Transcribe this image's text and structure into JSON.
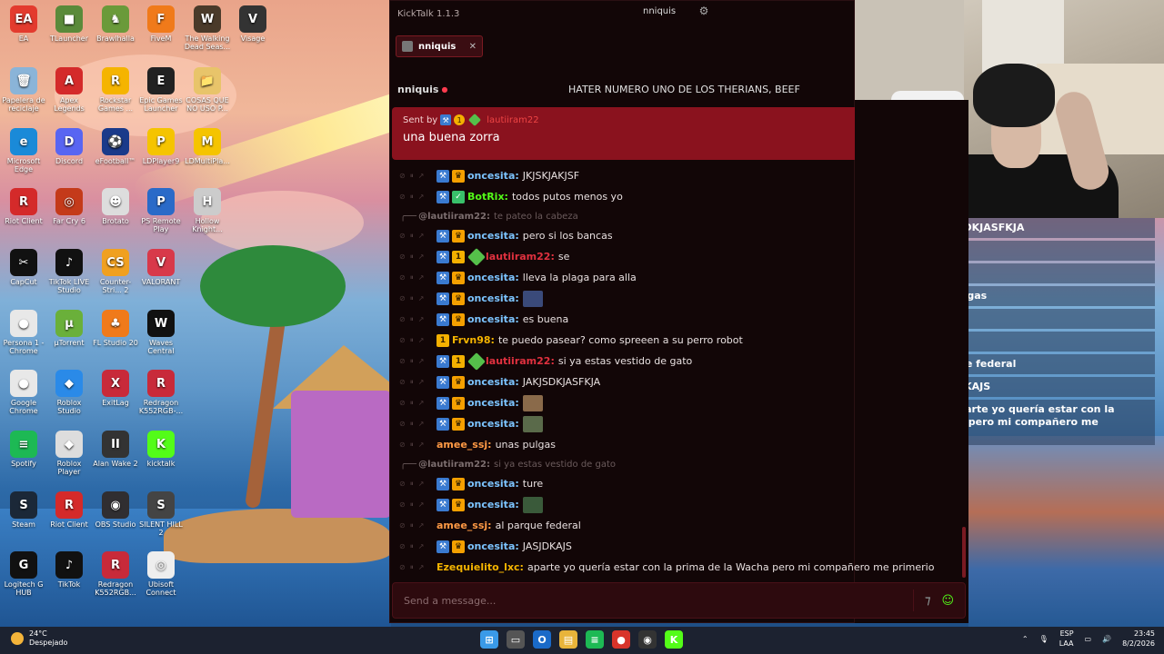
{
  "desktop": {
    "icons": [
      {
        "label": "EA",
        "color": "#e33b2e",
        "glyph": "EA"
      },
      {
        "label": "TLauncher",
        "color": "#5a8a3a",
        "glyph": "■"
      },
      {
        "label": "Brawlhalla",
        "color": "#6a9a3a",
        "glyph": "♞"
      },
      {
        "label": "FiveM",
        "color": "#f07a1a",
        "glyph": "F"
      },
      {
        "label": "The Walking Dead Seas...",
        "color": "#4a3a2a",
        "glyph": "W"
      },
      {
        "label": "Visage",
        "color": "#333",
        "glyph": "V"
      },
      {
        "label": "Papelera de reciclaje",
        "color": "#8ab4d8",
        "glyph": "🗑"
      },
      {
        "label": "Apex Legends",
        "color": "#d42a2a",
        "glyph": "A"
      },
      {
        "label": "Rockstar Games ...",
        "color": "#f5b400",
        "glyph": "R"
      },
      {
        "label": "Epic Games Launcher",
        "color": "#222",
        "glyph": "E"
      },
      {
        "label": "COSAS QUE NO USO P...",
        "color": "#e8c46a",
        "glyph": "📁"
      },
      {
        "label": "Microsoft Edge",
        "color": "#1a8ad8",
        "glyph": "e"
      },
      {
        "label": "Discord",
        "color": "#5865f2",
        "glyph": "D"
      },
      {
        "label": "eFootball™",
        "color": "#1a3a8a",
        "glyph": "⚽"
      },
      {
        "label": "LDPlayer9",
        "color": "#f5c400",
        "glyph": "P"
      },
      {
        "label": "LDMultiPla...",
        "color": "#f5c400",
        "glyph": "M"
      },
      {
        "label": "Riot Client",
        "color": "#d42a2a",
        "glyph": "R"
      },
      {
        "label": "Far Cry 6",
        "color": "#c43a1a",
        "glyph": "◎"
      },
      {
        "label": "Brotato",
        "color": "#ddd",
        "glyph": "☻"
      },
      {
        "label": "PS Remote Play",
        "color": "#2a6ac8",
        "glyph": "P"
      },
      {
        "label": "Hollow Knight...",
        "color": "#ccc",
        "glyph": "H"
      },
      {
        "label": "CapCut",
        "color": "#111",
        "glyph": "✂"
      },
      {
        "label": "TikTok LIVE Studio",
        "color": "#111",
        "glyph": "♪"
      },
      {
        "label": "Counter-Stri... 2",
        "color": "#f0a020",
        "glyph": "CS"
      },
      {
        "label": "VALORANT",
        "color": "#d8394a",
        "glyph": "V"
      },
      {
        "label": "Persona 1 - Chrome",
        "color": "#e8e8e8",
        "glyph": "●"
      },
      {
        "label": "µTorrent",
        "color": "#6ab03a",
        "glyph": "µ"
      },
      {
        "label": "FL Studio 20",
        "color": "#f07a1a",
        "glyph": "♣"
      },
      {
        "label": "Waves Central",
        "color": "#111",
        "glyph": "W"
      },
      {
        "label": "Google Chrome",
        "color": "#e8e8e8",
        "glyph": "●"
      },
      {
        "label": "Roblox Studio",
        "color": "#2a8ae8",
        "glyph": "◆"
      },
      {
        "label": "ExitLag",
        "color": "#c82a3a",
        "glyph": "X"
      },
      {
        "label": "Redragon K552RGB-...",
        "color": "#c82a3a",
        "glyph": "R"
      },
      {
        "label": "Spotify",
        "color": "#1db954",
        "glyph": "≡"
      },
      {
        "label": "Roblox Player",
        "color": "#ddd",
        "glyph": "◆"
      },
      {
        "label": "Alan Wake 2",
        "color": "#333",
        "glyph": "II"
      },
      {
        "label": "kicktalk",
        "color": "#53fc18",
        "glyph": "K"
      },
      {
        "label": "Steam",
        "color": "#1b2838",
        "glyph": "S"
      },
      {
        "label": "Riot Client",
        "color": "#d42a2a",
        "glyph": "R"
      },
      {
        "label": "OBS Studio",
        "color": "#302e31",
        "glyph": "◉"
      },
      {
        "label": "SILENT HILL 2",
        "color": "#444",
        "glyph": "S"
      },
      {
        "label": "Logitech G HUB",
        "color": "#111",
        "glyph": "G"
      },
      {
        "label": "TikTok",
        "color": "#111",
        "glyph": "♪"
      },
      {
        "label": "Redragon K552RGB...",
        "color": "#c82a3a",
        "glyph": "R"
      },
      {
        "label": "Ubisoft Connect",
        "color": "#eee",
        "glyph": "◎"
      }
    ]
  },
  "overlay": {
    "messages": [
      {
        "user": "oncesita:",
        "text": "JAKJSDKJASFKJA",
        "badges": true,
        "cls": "",
        "emote": false
      },
      {
        "user": "oncesita:",
        "text": "",
        "badges": true,
        "cls": "",
        "emote": true
      },
      {
        "user": "oncesita:",
        "text": "",
        "badges": true,
        "cls": "",
        "emote": true
      },
      {
        "user": "amee_ssj:",
        "text": "unas pulgas",
        "badges": false,
        "cls": "amee",
        "emote": false
      },
      {
        "user": "oncesita:",
        "text": "ture",
        "badges": true,
        "cls": "",
        "emote": false
      },
      {
        "user": "oncesita:",
        "text": "",
        "badges": true,
        "cls": "",
        "emote": true
      },
      {
        "user": "amee_ssj:",
        "text": "al parque federal",
        "badges": false,
        "cls": "amee",
        "emote": false
      },
      {
        "user": "oncesita:",
        "text": "JASJDKAJS",
        "badges": true,
        "cls": "",
        "emote": false
      },
      {
        "user": "Ezequielito_lxc:",
        "text": "aparte yo quería estar con la prima de la Wacha pero mi compañero me primerio",
        "badges": false,
        "cls": "ezq",
        "emote": false
      }
    ]
  },
  "kicktalk": {
    "app_title": "KickTalk 1.1.3",
    "username": "nniquis",
    "tab_label": "nniquis",
    "channel_name": "nniquis",
    "stream_title": "HATER NUMERO UNO DE LOS THERIANS, BEEF",
    "reply_banner": {
      "sent_by_label": "Sent by",
      "sender": "lautiiram22",
      "message": "una buena zorra"
    },
    "chat": [
      {
        "type": "msg",
        "badges": [
          "mod",
          "vip"
        ],
        "user": "oncesita:",
        "color": "#7cc4ff",
        "text": "JKJSKJAKJSF"
      },
      {
        "type": "msg",
        "badges": [
          "mod",
          "og"
        ],
        "user": "BotRix:",
        "color": "#53fc18",
        "text": "todos putos menos yo"
      },
      {
        "type": "reply",
        "user": "@lautiiram22:",
        "text": "te pateo la cabeza"
      },
      {
        "type": "msg",
        "badges": [
          "mod",
          "vip"
        ],
        "user": "oncesita:",
        "color": "#7cc4ff",
        "text": "pero si los bancas"
      },
      {
        "type": "msg",
        "badges": [
          "mod",
          "sub",
          "gift"
        ],
        "user": "lautiiram22:",
        "color": "#e0313f",
        "text": "se"
      },
      {
        "type": "msg",
        "badges": [
          "mod",
          "vip"
        ],
        "user": "oncesita:",
        "color": "#7cc4ff",
        "text": "lleva la plaga para alla"
      },
      {
        "type": "msg",
        "badges": [
          "mod",
          "vip"
        ],
        "user": "oncesita:",
        "color": "#7cc4ff",
        "text": "",
        "emote": "#3a4a7a"
      },
      {
        "type": "msg",
        "badges": [
          "mod",
          "vip"
        ],
        "user": "oncesita:",
        "color": "#7cc4ff",
        "text": "es buena"
      },
      {
        "type": "msg",
        "badges": [
          "sub"
        ],
        "user": "Frvn98:",
        "color": "#f5b400",
        "text": "te puedo pasear? como spreeen a su perro robot"
      },
      {
        "type": "msg",
        "badges": [
          "mod",
          "sub",
          "gift"
        ],
        "user": "lautiiram22:",
        "color": "#e0313f",
        "text": "si ya estas vestido de gato"
      },
      {
        "type": "msg",
        "badges": [
          "mod",
          "vip"
        ],
        "user": "oncesita:",
        "color": "#7cc4ff",
        "text": "JAKJSDKJASFKJA"
      },
      {
        "type": "msg",
        "badges": [
          "mod",
          "vip"
        ],
        "user": "oncesita:",
        "color": "#7cc4ff",
        "text": "",
        "emote": "#8a6a4a"
      },
      {
        "type": "msg",
        "badges": [
          "mod",
          "vip"
        ],
        "user": "oncesita:",
        "color": "#7cc4ff",
        "text": "",
        "emote": "#5a6a4a"
      },
      {
        "type": "msg",
        "badges": [],
        "user": "amee_ssj:",
        "color": "#ff9a45",
        "text": "unas pulgas"
      },
      {
        "type": "reply",
        "user": "@lautiiram22:",
        "text": "si ya estas vestido de gato"
      },
      {
        "type": "msg",
        "badges": [
          "mod",
          "vip"
        ],
        "user": "oncesita:",
        "color": "#7cc4ff",
        "text": "ture"
      },
      {
        "type": "msg",
        "badges": [
          "mod",
          "vip"
        ],
        "user": "oncesita:",
        "color": "#7cc4ff",
        "text": "",
        "emote": "#3a5a3a"
      },
      {
        "type": "msg",
        "badges": [],
        "user": "amee_ssj:",
        "color": "#ff9a45",
        "text": "al parque federal"
      },
      {
        "type": "msg",
        "badges": [
          "mod",
          "vip"
        ],
        "user": "oncesita:",
        "color": "#7cc4ff",
        "text": "JASJDKAJS"
      },
      {
        "type": "msg",
        "badges": [],
        "user": "Ezequielito_lxc:",
        "color": "#f5b400",
        "text": "aparte yo quería estar con la prima de la Wacha pero mi compañero me primerio"
      }
    ],
    "input_placeholder": "Send a message..."
  },
  "taskbar": {
    "temperature": "24°C",
    "weather_desc": "Despejado",
    "lang_top": "ESP",
    "lang_bottom": "LAA",
    "time": "23:45",
    "date": "8/2/2026",
    "apps": [
      {
        "name": "start-button",
        "color": "#3a9ae8",
        "glyph": "⊞"
      },
      {
        "name": "task-view-button",
        "color": "#555",
        "glyph": "▭"
      },
      {
        "name": "outlook-app",
        "color": "#1a6ac8",
        "glyph": "O"
      },
      {
        "name": "file-explorer-app",
        "color": "#e8b43a",
        "glyph": "▤"
      },
      {
        "name": "spotify-app",
        "color": "#1db954",
        "glyph": "≡"
      },
      {
        "name": "chrome-app",
        "color": "#d8342a",
        "glyph": "●"
      },
      {
        "name": "obs-app",
        "color": "#333",
        "glyph": "◉"
      },
      {
        "name": "kicktalk-app",
        "color": "#53fc18",
        "glyph": "K"
      }
    ]
  },
  "colors": {
    "accent": "#53fc18",
    "kick_red": "#8a121e"
  }
}
